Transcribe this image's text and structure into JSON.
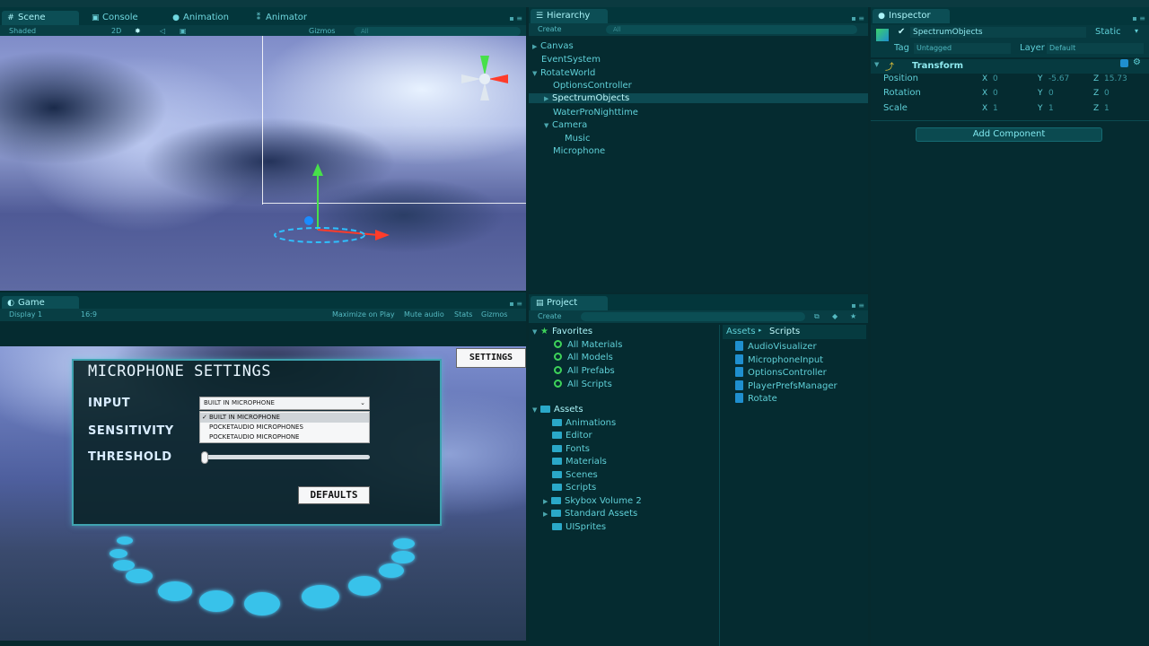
{
  "colors": {
    "accent": "#0c4e55",
    "text": "#5fd0d8",
    "bright": "#bff8fb",
    "green": "#3ed35a"
  },
  "scene": {
    "tabs": [
      {
        "label": "Scene",
        "icon": "scene-icon"
      },
      {
        "label": "Console",
        "icon": "console-icon"
      },
      {
        "label": "Animation",
        "icon": "animation-icon"
      },
      {
        "label": "Animator",
        "icon": "animator-icon"
      }
    ],
    "toolbar": {
      "shading": "Shaded",
      "mode_2d": "2D",
      "gizmos": "Gizmos",
      "search": "All"
    }
  },
  "game": {
    "tab": "Game",
    "toolbar": {
      "display": "Display 1",
      "aspect": "16:9",
      "maximize": "Maximize on Play",
      "mute": "Mute audio",
      "stats": "Stats",
      "gizmos": "Gizmos"
    },
    "settings_button": "SETTINGS",
    "panel": {
      "title": "MICROPHONE SETTINGS",
      "input_label": "INPUT",
      "sensitivity_label": "SENSITIVITY",
      "threshold_label": "THRESHOLD",
      "dropdown_value": "BUILT IN MICROPHONE",
      "options": [
        "BUILT IN MICROPHONE",
        "POCKETAUDIO MICROPHONES",
        "POCKETAUDIO MICROPHONE"
      ],
      "defaults_button": "DEFAULTS",
      "threshold": 0.0
    }
  },
  "hierarchy": {
    "tab": "Hierarchy",
    "create": "Create",
    "search": "All",
    "items": [
      "Canvas",
      "EventSystem",
      "RotateWorld",
      "OptionsController",
      "SpectrumObjects",
      "WaterProNighttime",
      "Camera",
      "Music",
      "Microphone"
    ]
  },
  "inspector": {
    "tab": "Inspector",
    "object_name": "SpectrumObjects",
    "static_label": "Static",
    "tag_label": "Tag",
    "tag_value": "Untagged",
    "layer_label": "Layer",
    "layer_value": "Default",
    "transform_label": "Transform",
    "position_label": "Position",
    "rotation_label": "Rotation",
    "scale_label": "Scale",
    "position": {
      "x": "0",
      "y": "-5.67",
      "z": "15.73"
    },
    "rotation": {
      "x": "0",
      "y": "0",
      "z": "0"
    },
    "scale": {
      "x": "1",
      "y": "1",
      "z": "1"
    },
    "add_component": "Add Component"
  },
  "project": {
    "tab": "Project",
    "create": "Create",
    "favorites_label": "Favorites",
    "favorites": [
      "All Materials",
      "All Models",
      "All Prefabs",
      "All Scripts"
    ],
    "assets_label": "Assets",
    "folders": [
      "Animations",
      "Editor",
      "Fonts",
      "Materials",
      "Scenes",
      "Scripts",
      "Skybox Volume 2",
      "Standard Assets",
      "UISprites"
    ],
    "breadcrumb": {
      "root": "Assets",
      "current": "Scripts"
    },
    "scripts": [
      "AudioVisualizer",
      "MicrophoneInput",
      "OptionsController",
      "PlayerPrefsManager",
      "Rotate"
    ]
  }
}
